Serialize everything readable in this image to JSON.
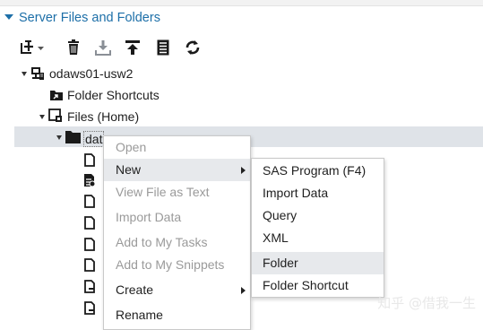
{
  "panel": {
    "title": "Server Files and Folders"
  },
  "toolbar": {
    "items": [
      {
        "icon": "new-dropdown-icon"
      },
      {
        "icon": "delete-icon"
      },
      {
        "icon": "download-icon"
      },
      {
        "icon": "upload-icon"
      },
      {
        "icon": "properties-icon"
      },
      {
        "icon": "refresh-icon"
      }
    ]
  },
  "tree": {
    "server": "odaws01-usw2",
    "folder_shortcuts": "Folder Shortcuts",
    "files_home": "Files (Home)",
    "selected_folder": "dat"
  },
  "context_menu": {
    "items": [
      {
        "label": "Open",
        "enabled": false
      },
      {
        "label": "New",
        "enabled": true,
        "submenu": true
      },
      {
        "label": "View File as Text",
        "enabled": false
      },
      {
        "label": "Import Data",
        "enabled": false
      },
      {
        "label": "Add to My Tasks",
        "enabled": false
      },
      {
        "label": "Add to My Snippets",
        "enabled": false
      },
      {
        "label": "Create",
        "enabled": true,
        "submenu": true
      },
      {
        "label": "Rename",
        "enabled": true
      }
    ]
  },
  "submenu": {
    "items": [
      {
        "label": "SAS Program (F4)"
      },
      {
        "label": "Import Data"
      },
      {
        "label": "Query"
      },
      {
        "label": "XML"
      },
      {
        "label": "Folder"
      },
      {
        "label": "Folder Shortcut"
      }
    ]
  },
  "watermark": "知乎 @借我一生",
  "colors": {
    "accent": "#1d6fa8",
    "selection": "#dfe3e8",
    "menu_highlight": "#e7e9ec"
  }
}
